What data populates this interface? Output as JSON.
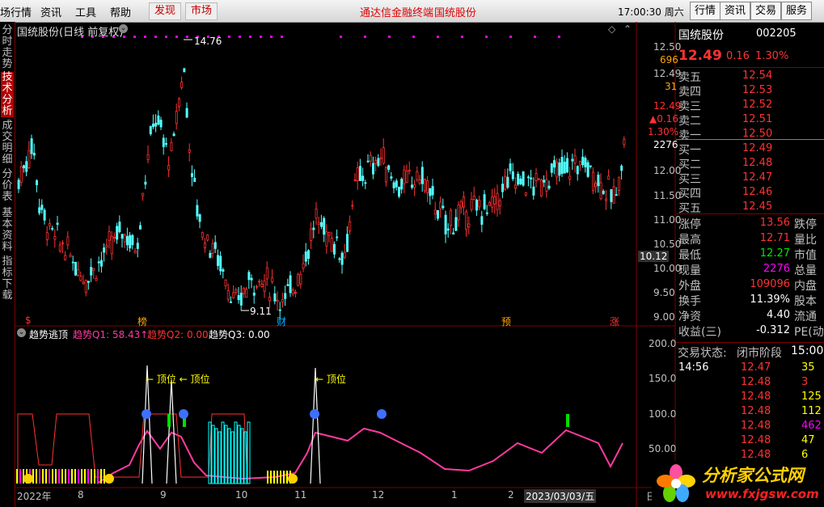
{
  "menubar": {
    "first": "场行情",
    "info": "资讯",
    "tools": "工具",
    "help": "帮助",
    "discover": "发现",
    "market": "市场",
    "center_title": "通达信金融终端",
    "center_stock": "国统股份",
    "clock": "17:00:30 周六",
    "r_quote": "行情",
    "r_info": "资讯",
    "r_trade": "交易",
    "r_service": "服务"
  },
  "lefttabs": [
    {
      "label": "分时走势"
    },
    {
      "label": "技术分析"
    },
    {
      "label": "成交明细"
    },
    {
      "label": "分价表"
    },
    {
      "label": "基本资料"
    },
    {
      "label": "指标下载"
    }
  ],
  "chart": {
    "title": "国统股份(日线 前复权)",
    "high_mark": "14.76",
    "low_mark": "9.11",
    "price_axis": [
      "12.50",
      "12.00",
      "11.50",
      "11.00",
      "10.50",
      "10.00",
      "9.50",
      "9.00"
    ],
    "side_values": {
      "v1": "12.50",
      "v2": "696",
      "v3": "12.49",
      "v4": "31",
      "v5": "12.49",
      "v6": "▲0.16",
      "v7": "1.30%",
      "v8": "2276",
      "cur": "10.12"
    },
    "markers": [
      "$",
      "榜",
      "财",
      "预",
      "涨"
    ]
  },
  "indicator": {
    "name": "趋势逃顶",
    "q1": "趋势Q1: 58.43↑",
    "q2": "趋势Q2: 0.00",
    "q3": "趋势Q3: 0.00",
    "axis": [
      "200.0",
      "150.0",
      "100.0",
      "50.00"
    ],
    "annot1": "← 顶位 ← 顶位",
    "annot2": "← 顶位"
  },
  "dates": [
    "2022年",
    "8",
    "9",
    "10",
    "11",
    "12",
    "1",
    "2",
    "2023/03/03/五",
    "日"
  ],
  "quote": {
    "name": "国统股份",
    "code": "002205",
    "price": "12.49",
    "chg": "0.16",
    "pct": "1.30%",
    "asks": [
      {
        "l": "卖五",
        "p": "12.54"
      },
      {
        "l": "卖四",
        "p": "12.53"
      },
      {
        "l": "卖三",
        "p": "12.52"
      },
      {
        "l": "卖二",
        "p": "12.51"
      },
      {
        "l": "卖一",
        "p": "12.50"
      }
    ],
    "bids": [
      {
        "l": "买一",
        "p": "12.49"
      },
      {
        "l": "买二",
        "p": "12.48"
      },
      {
        "l": "买三",
        "p": "12.47"
      },
      {
        "l": "买四",
        "p": "12.46"
      },
      {
        "l": "买五",
        "p": "12.45"
      }
    ],
    "stats": [
      {
        "l": "涨停",
        "v": "13.56",
        "r": "跌停"
      },
      {
        "l": "最高",
        "v": "12.71",
        "r": "量比"
      },
      {
        "l": "最低",
        "v": "12.27",
        "r": "市值"
      },
      {
        "l": "现量",
        "v": "2276",
        "r": "总量"
      },
      {
        "l": "外盘",
        "v": "109096",
        "r": "内盘"
      },
      {
        "l": "换手",
        "v": "11.39%",
        "r": "股本"
      },
      {
        "l": "净资",
        "v": "4.40",
        "r": "流通"
      },
      {
        "l": "收益(三)",
        "v": "-0.312",
        "r": "PE(动)"
      }
    ],
    "status_label": "交易状态:",
    "status": "闭市阶段",
    "status_time": "15:00",
    "ticks": [
      {
        "t": "14:56",
        "p": "12.47",
        "v": "35"
      },
      {
        "t": "",
        "p": "12.48",
        "v": "3"
      },
      {
        "t": "",
        "p": "12.48",
        "v": "125"
      },
      {
        "t": "",
        "p": "12.48",
        "v": "112"
      },
      {
        "t": "",
        "p": "12.48",
        "v": "462"
      },
      {
        "t": "",
        "p": "12.48",
        "v": "47"
      },
      {
        "t": "",
        "p": "12.48",
        "v": "6"
      }
    ]
  },
  "logo": {
    "name": "分析家公式网",
    "url": "www.fxjgsw.com"
  }
}
